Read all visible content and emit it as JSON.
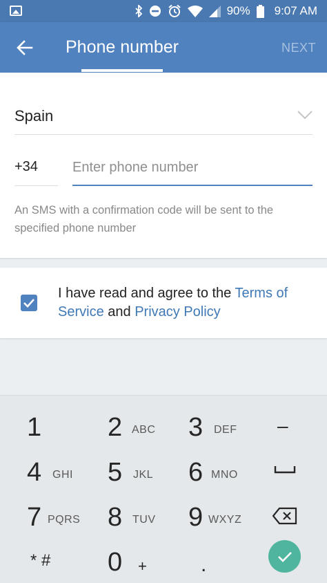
{
  "status_bar": {
    "battery": "90%",
    "time": "9:07 AM",
    "icons": [
      "image-icon",
      "bluetooth-icon",
      "do-not-disturb-icon",
      "alarm-icon",
      "wifi-icon",
      "signal-icon",
      "battery-icon"
    ]
  },
  "app_bar": {
    "title": "Phone number",
    "next_label": "NEXT",
    "back_icon": "arrow-left-icon"
  },
  "form": {
    "country": "Spain",
    "country_code": "+34",
    "phone_placeholder": "Enter phone number",
    "phone_value": "",
    "sms_hint": "An SMS with a confirmation code will be sent to the specified phone number"
  },
  "terms": {
    "checked": true,
    "text_before": "I have read and agree to the ",
    "terms_link": "Terms of Service",
    "text_middle": " and ",
    "privacy_link": "Privacy Policy"
  },
  "keypad": {
    "keys": [
      {
        "digit": "1",
        "letters": ""
      },
      {
        "digit": "2",
        "letters": "ABC"
      },
      {
        "digit": "3",
        "letters": "DEF"
      },
      {
        "digit": "4",
        "letters": "GHI"
      },
      {
        "digit": "5",
        "letters": "JKL"
      },
      {
        "digit": "6",
        "letters": "MNO"
      },
      {
        "digit": "7",
        "letters": "PQRS"
      },
      {
        "digit": "8",
        "letters": "TUV"
      },
      {
        "digit": "9",
        "letters": "WXYZ"
      },
      {
        "digit": "0",
        "letters": "+"
      }
    ],
    "symbols": {
      "star_hash": "* #",
      "dash": "–",
      "dot": "."
    },
    "special_icons": [
      "space-icon",
      "backspace-icon",
      "done-check-icon"
    ]
  },
  "colors": {
    "status_bar": "#4a79b1",
    "app_bar": "#5082c0",
    "link": "#3f79b5",
    "done_button": "#4fb59e"
  }
}
